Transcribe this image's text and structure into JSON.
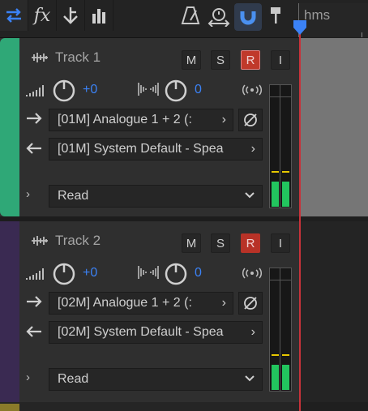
{
  "toolbar": {
    "icons": [
      "swap-arrows-icon",
      "fx-icon",
      "routing-icon",
      "bars-icon",
      "metronome-icon",
      "loop-record-icon",
      "snap-magnet-icon",
      "marker-pin-icon"
    ],
    "fx_label": "fx"
  },
  "ruler": {
    "unit_label": "hms"
  },
  "tracks": [
    {
      "name": "Track 1",
      "color": "#2fa877",
      "buttons": [
        "M",
        "S",
        "R",
        "I"
      ],
      "volume_value": "+0",
      "pan_value": "0",
      "input": "[01M] Analogue 1 + 2 (:",
      "output": "[01M] System Default - Spea",
      "automation_mode": "Read"
    },
    {
      "name": "Track 2",
      "color": "#3a2a52",
      "buttons": [
        "M",
        "S",
        "R",
        "I"
      ],
      "volume_value": "+0",
      "pan_value": "0",
      "input": "[02M] Analogue 1 + 2 (:",
      "output": "[02M] System Default - Spea",
      "automation_mode": "Read"
    }
  ],
  "colors": {
    "accent": "#3b82f6",
    "record": "#c0392b",
    "meter_level": "#22c55e",
    "meter_peak": "#e6c700",
    "playhead": "#c8323a"
  }
}
